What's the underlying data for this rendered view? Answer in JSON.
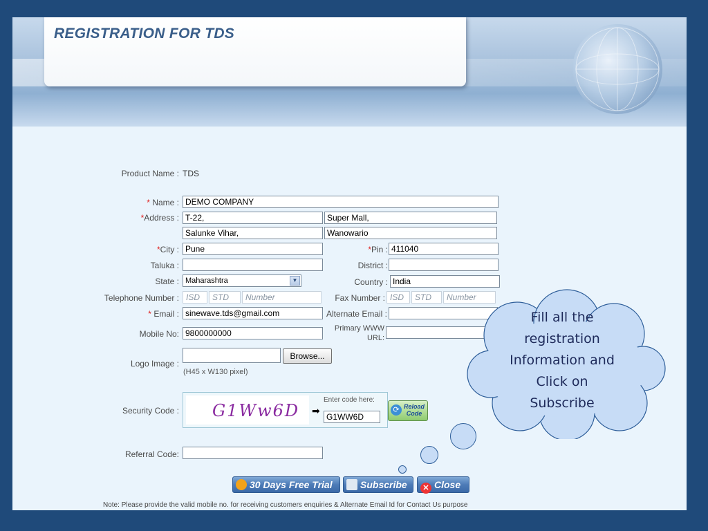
{
  "header": {
    "title": "REGISTRATION FOR TDS"
  },
  "form": {
    "product_label": "Product Name :",
    "product_value": "TDS",
    "name_label": "Name :",
    "name_value": "DEMO COMPANY",
    "address_label": "Address :",
    "address1": "T-22,",
    "address2": "Super Mall,",
    "address3": "Salunke Vihar,",
    "address4": "Wanowario",
    "city_label": "City :",
    "city_value": "Pune",
    "pin_label": "Pin :",
    "pin_value": "411040",
    "taluka_label": "Taluka :",
    "taluka_value": "",
    "district_label": "District :",
    "district_value": "",
    "state_label": "State :",
    "state_value": "Maharashtra",
    "country_label": "Country :",
    "country_value": "India",
    "telephone_label": "Telephone Number :",
    "fax_label": "Fax Number :",
    "ph_isd": "ISD",
    "ph_std": "STD",
    "ph_number": "Number",
    "email_label": "Email :",
    "email_value": "sinewave.tds@gmail.com",
    "alt_email_label": "Alternate Email :",
    "alt_email_value": "",
    "mobile_label": "Mobile No:",
    "mobile_value": "9800000000",
    "www_label_1": "Primary WWW",
    "www_label_2": "URL:",
    "www_value": "",
    "logo_label": "Logo Image :",
    "logo_value": "",
    "browse_label": "Browse...",
    "logo_hint": "(H45 x W130 pixel)",
    "security_label": "Security Code :",
    "captcha_text": "G1Ww6D",
    "enter_code_label": "Enter code here:",
    "enter_code_value": "G1WW6D",
    "reload_label_1": "Reload",
    "reload_label_2": "Code",
    "referral_label": "Referral Code:",
    "referral_value": ""
  },
  "buttons": {
    "trial": "30 Days Free Trial",
    "subscribe": "Subscribe",
    "close": "Close"
  },
  "note": "Note: Please provide the valid mobile no. for receiving customers enquiries & Alternate Email Id for Contact Us purpose",
  "callout": {
    "line1": "Fill all the",
    "line2": "registration",
    "line3": "Information and",
    "line4": "Click on",
    "line5": "Subscribe"
  },
  "colors": {
    "required": "#e0201e",
    "button": "#4d7bb7",
    "cloud": "#c7dcf6"
  }
}
